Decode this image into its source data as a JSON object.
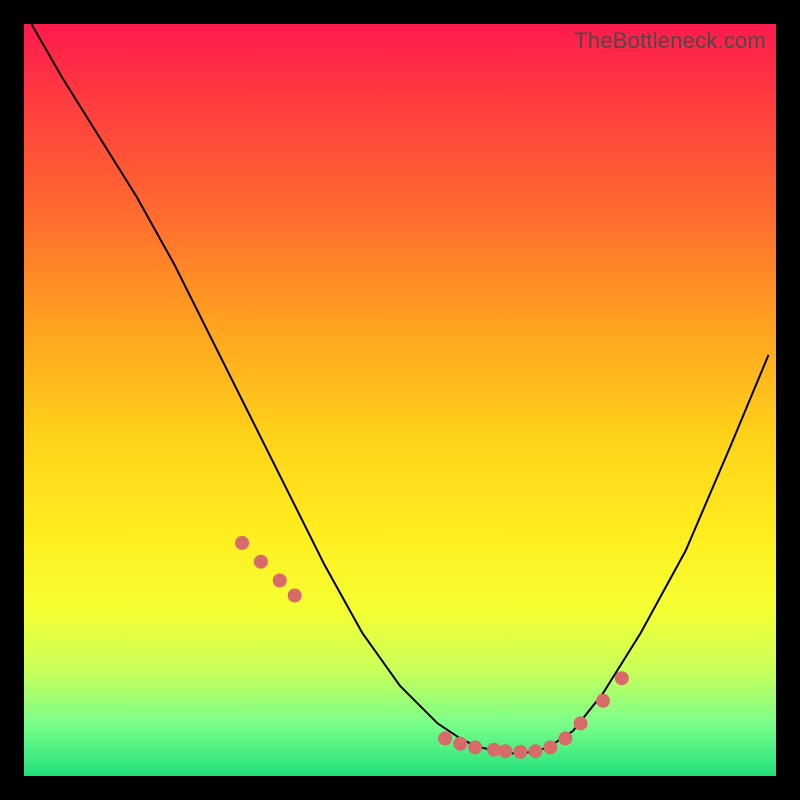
{
  "watermark": "TheBottleneck.com",
  "colors": {
    "dot": "#d86a6a",
    "curve": "#000000",
    "background_border": "#000000"
  },
  "chart_data": {
    "type": "line",
    "title": "",
    "xlabel": "",
    "ylabel": "",
    "xlim": [
      0,
      100
    ],
    "ylim": [
      0,
      100
    ],
    "grid": false,
    "series": [
      {
        "name": "bottleneck-curve",
        "x": [
          1,
          5,
          10,
          15,
          20,
          25,
          30,
          35,
          40,
          45,
          50,
          55,
          58,
          60,
          62,
          65,
          68,
          70,
          73,
          77,
          82,
          88,
          94,
          99
        ],
        "y": [
          100,
          93,
          85,
          77,
          68,
          58,
          48,
          38,
          28,
          19,
          12,
          7,
          5,
          4,
          3.5,
          3,
          3.2,
          4,
          6,
          11,
          19,
          30,
          44,
          56
        ]
      }
    ],
    "markers": {
      "name": "highlight-dots",
      "x": [
        29,
        31.5,
        34,
        36,
        56,
        58,
        60,
        62.5,
        64,
        66,
        68,
        70,
        72,
        74,
        77,
        79.5
      ],
      "y": [
        31,
        28.5,
        26,
        24,
        5.0,
        4.3,
        3.8,
        3.5,
        3.3,
        3.2,
        3.3,
        3.8,
        5.0,
        7.0,
        10.0,
        13.0
      ]
    }
  }
}
